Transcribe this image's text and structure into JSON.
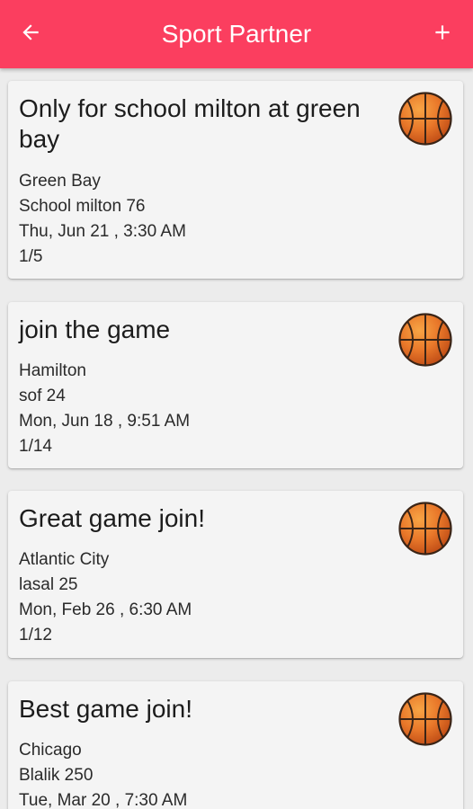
{
  "header": {
    "title": "Sport Partner",
    "back_icon": "arrow-left-icon",
    "add_icon": "plus-icon",
    "bar_color": "#fb3e5f"
  },
  "games": [
    {
      "title": "Only for school milton at green bay",
      "city": "Green Bay",
      "location": "School milton 76",
      "datetime": "Thu, Jun 21 , 3:30 AM",
      "players": "1/5",
      "icon": "basketball-icon"
    },
    {
      "title": "join the game",
      "city": "Hamilton",
      "location": "sof 24",
      "datetime": "Mon, Jun 18 , 9:51 AM",
      "players": "1/14",
      "icon": "basketball-icon"
    },
    {
      "title": "Great game join!",
      "city": "Atlantic City",
      "location": "lasal 25",
      "datetime": "Mon, Feb 26 , 6:30 AM",
      "players": "1/12",
      "icon": "basketball-icon"
    },
    {
      "title": "Best game join!",
      "city": "Chicago",
      "location": "Blalik 250",
      "datetime": "Tue, Mar 20 , 7:30 AM",
      "players": "",
      "icon": "basketball-icon"
    }
  ]
}
